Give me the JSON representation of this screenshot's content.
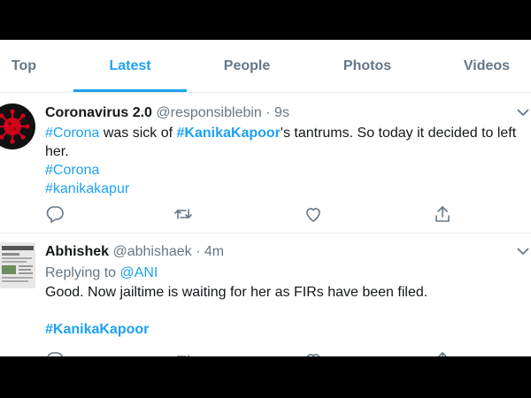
{
  "tabs": [
    {
      "label": "Top"
    },
    {
      "label": "Latest"
    },
    {
      "label": "People"
    },
    {
      "label": "Photos"
    },
    {
      "label": "Videos"
    }
  ],
  "active_tab": "Latest",
  "colors": {
    "accent": "#1da1f2",
    "muted": "#657786",
    "text": "#14171a",
    "avatar_red": "#d0021b"
  },
  "tweets": [
    {
      "name": "Coronavirus 2.0",
      "handle": "@responsiblebin",
      "separator": "·",
      "time": "9s",
      "text_line1_tag1": "#Corona",
      "text_line1_mid": " was sick of ",
      "text_line1_tag2": "#KanikaKapoor",
      "text_line1_rest": "'s tantrums. So today it decided to left",
      "text_line2": "her.",
      "hashtag1": "#Corona",
      "hashtag2": "#kanikakapur",
      "avatar_icon": "virus-icon"
    },
    {
      "name": "Abhishek",
      "handle": "@abhishaek",
      "separator": "·",
      "time": "4m",
      "replying_prefix": "Replying to ",
      "replying_handle": "@ANI",
      "text": "Good. Now jailtime is waiting for her as FIRs have been filed.",
      "hashtag": "#KanikaKapoor",
      "avatar_icon": "newspaper-avatar"
    }
  ]
}
